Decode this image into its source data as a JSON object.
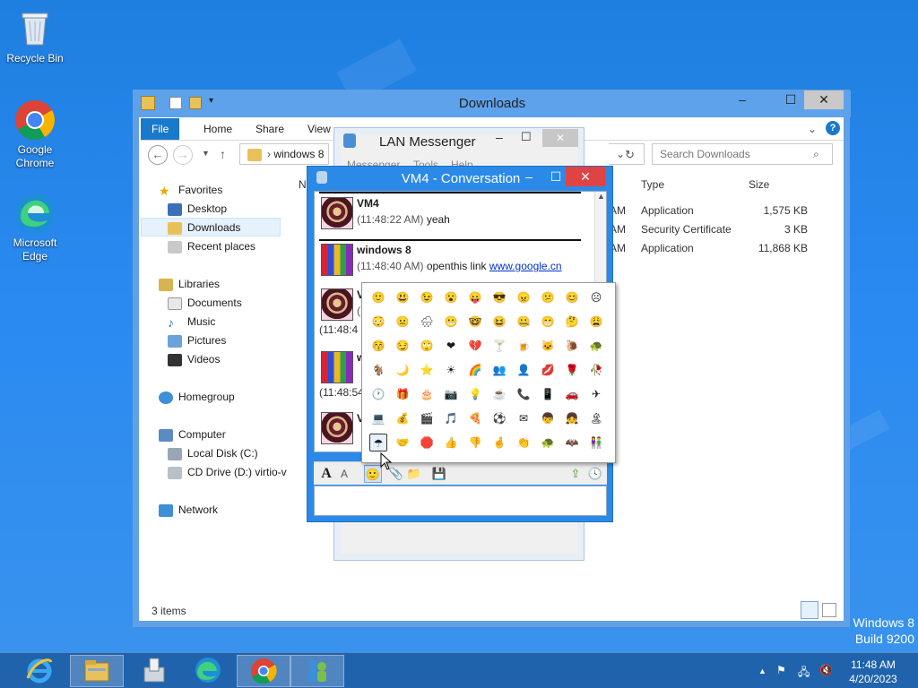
{
  "desktop": {
    "icons": [
      {
        "label": "Recycle Bin",
        "icon": "recycle-bin-icon"
      },
      {
        "label": "Google Chrome",
        "icon": "chrome-icon"
      },
      {
        "label": "Microsoft Edge",
        "icon": "edge-icon"
      }
    ],
    "watermark": {
      "line1": "Windows 8",
      "line2": "Build 9200"
    }
  },
  "explorer": {
    "title": "Downloads",
    "tabs": [
      "File",
      "Home",
      "Share",
      "View"
    ],
    "address": "windows 8",
    "search_placeholder": "Search Downloads",
    "nav": {
      "favorites": "Favorites",
      "desktop": "Desktop",
      "downloads": "Downloads",
      "recent": "Recent places",
      "libraries": "Libraries",
      "documents": "Documents",
      "music": "Music",
      "pictures": "Pictures",
      "videos": "Videos",
      "homegroup": "Homegroup",
      "computer": "Computer",
      "local_disk": "Local Disk (C:)",
      "cd_drive": "CD Drive (D:) virtio-v",
      "network": "Network"
    },
    "columns": {
      "name_partial": "N",
      "type": "Type",
      "size": "Size"
    },
    "files": [
      {
        "time_partial": "AM",
        "type": "Application",
        "size": "1,575 KB"
      },
      {
        "time_partial": "AM",
        "type": "Security Certificate",
        "size": "3 KB"
      },
      {
        "time_partial": "AM",
        "type": "Application",
        "size": "11,868 KB"
      }
    ],
    "status": "3 items"
  },
  "lan_messenger": {
    "title": "LAN Messenger",
    "menu": [
      "Messenger",
      "Tools",
      "Help"
    ]
  },
  "conversation": {
    "title": "VM4 - Conversation",
    "messages": [
      {
        "sender": "VM4",
        "time": "(11:48:22 AM)",
        "text": "yeah"
      },
      {
        "sender": "windows 8",
        "time": "(11:48:40 AM)",
        "text": "openthis link ",
        "link": "www.google.cn"
      },
      {
        "sender": "V",
        "time": "(",
        "text": ""
      },
      {
        "sender": "w",
        "time": "(11:48:4",
        "text": ""
      },
      {
        "sender": "V",
        "time": "(11:48:54",
        "text": ""
      }
    ]
  },
  "emoticons": [
    "🙂",
    "😃",
    "😉",
    "😮",
    "😛",
    "😎",
    "😠",
    "😕",
    "😊",
    "☹",
    "😳",
    "😐",
    "🌧",
    "😬",
    "🤓",
    "😆",
    "🤐",
    "😁",
    "🤔",
    "😩",
    "😚",
    "😏",
    "🙄",
    "❤",
    "💔",
    "🍸",
    "🍺",
    "🐱",
    "🐌",
    "🐢",
    "🐐",
    "🌙",
    "⭐",
    "☀",
    "🌈",
    "👥",
    "👤",
    "💋",
    "🌹",
    "🥀",
    "🕐",
    "🎁",
    "🎂",
    "📷",
    "💡",
    "☕",
    "📞",
    "📱",
    "🚗",
    "✈",
    "💻",
    "💰",
    "🎬",
    "🎵",
    "🍕",
    "⚽",
    "✉",
    "👦",
    "👧",
    "🏝",
    "☂",
    "🤝",
    "🛑",
    "👍",
    "👎",
    "🤞",
    "👏",
    "🐢",
    "🦇",
    "👫"
  ],
  "taskbar": {
    "clock_time": "11:48 AM",
    "clock_date": "4/20/2023"
  }
}
